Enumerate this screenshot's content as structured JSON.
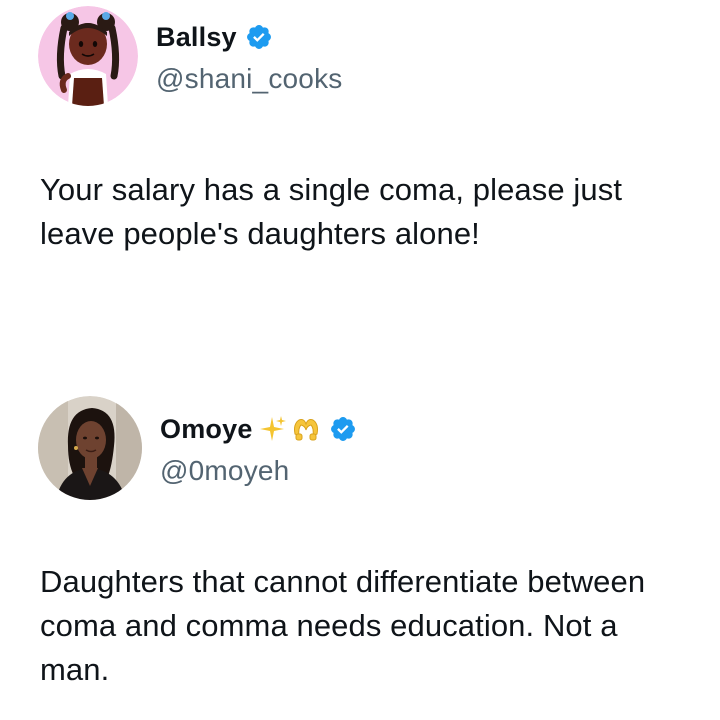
{
  "tweets": [
    {
      "display_name": "Ballsy",
      "handle": "@shani_cooks",
      "verified": true,
      "avatar": "cartoon-girl-avatar",
      "text": "Your salary has a single coma, please just leave people's daughters alone!"
    },
    {
      "display_name": "Omoye",
      "handle": "@0moyeh",
      "verified": true,
      "name_emojis": [
        "sparkles-icon",
        "heart-hands-icon"
      ],
      "avatar": "woman-photo-avatar",
      "text": "Daughters that cannot differentiate between coma and comma needs education. Not a man."
    }
  ],
  "colors": {
    "verified_blue": "#1d9bf0",
    "text": "#0f1419",
    "secondary_text": "#536471",
    "avatar1_bg": "#f6c6e6",
    "sparkle": "#f4c430"
  }
}
